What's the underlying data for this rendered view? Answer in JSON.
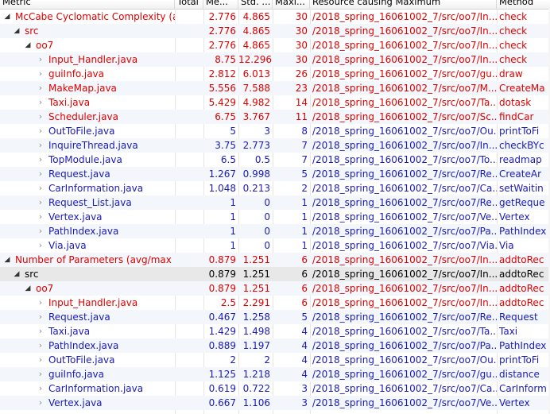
{
  "headers": {
    "metric": "Metric",
    "total": "Total",
    "mean": "Me...",
    "std": "Std. ...",
    "max": "Maxi...",
    "resource": "Resource causing Maximum",
    "method": "Method"
  },
  "rows": [
    {
      "metric": "McCabe Cyclomatic Complexity (a",
      "mean": "2.776",
      "std": "4.865",
      "max": "30",
      "resource": "/2018_spring_16061002_7/src/oo7/In...",
      "method": "check",
      "color": "red",
      "level": 0,
      "expander": "expanded"
    },
    {
      "metric": "src",
      "mean": "2.776",
      "std": "4.865",
      "max": "30",
      "resource": "/2018_spring_16061002_7/src/oo7/In...",
      "method": "check",
      "color": "red",
      "level": 1,
      "expander": "expanded"
    },
    {
      "metric": "oo7",
      "mean": "2.776",
      "std": "4.865",
      "max": "30",
      "resource": "/2018_spring_16061002_7/src/oo7/In...",
      "method": "check",
      "color": "red",
      "level": 2,
      "expander": "expanded"
    },
    {
      "metric": "Input_Handler.java",
      "mean": "8.75",
      "std": "12.296",
      "max": "30",
      "resource": "/2018_spring_16061002_7/src/oo7/In...",
      "method": "check",
      "color": "red",
      "level": 3,
      "expander": "collapsed"
    },
    {
      "metric": "guiInfo.java",
      "mean": "2.812",
      "std": "6.013",
      "max": "26",
      "resource": "/2018_spring_16061002_7/src/oo7/gu...",
      "method": "draw",
      "color": "red",
      "level": 3,
      "expander": "collapsed"
    },
    {
      "metric": "MakeMap.java",
      "mean": "5.556",
      "std": "7.588",
      "max": "23",
      "resource": "/2018_spring_16061002_7/src/oo7/M...",
      "method": "CreateMa",
      "color": "red",
      "level": 3,
      "expander": "collapsed"
    },
    {
      "metric": "Taxi.java",
      "mean": "5.429",
      "std": "4.982",
      "max": "14",
      "resource": "/2018_spring_16061002_7/src/oo7/Ta...",
      "method": "dotask",
      "color": "red",
      "level": 3,
      "expander": "collapsed"
    },
    {
      "metric": "Scheduler.java",
      "mean": "6.75",
      "std": "3.767",
      "max": "11",
      "resource": "/2018_spring_16061002_7/src/oo7/Sc...",
      "method": "findCar",
      "color": "red",
      "level": 3,
      "expander": "collapsed"
    },
    {
      "metric": "OutToFile.java",
      "mean": "5",
      "std": "3",
      "max": "8",
      "resource": "/2018_spring_16061002_7/src/oo7/Ou...",
      "method": "printToFi",
      "color": "blue",
      "level": 3,
      "expander": "collapsed"
    },
    {
      "metric": "InquireThread.java",
      "mean": "3.75",
      "std": "2.773",
      "max": "7",
      "resource": "/2018_spring_16061002_7/src/oo7/In...",
      "method": "checkBYc",
      "color": "blue",
      "level": 3,
      "expander": "collapsed"
    },
    {
      "metric": "TopModule.java",
      "mean": "6.5",
      "std": "0.5",
      "max": "7",
      "resource": "/2018_spring_16061002_7/src/oo7/To...",
      "method": "readmap",
      "color": "blue",
      "level": 3,
      "expander": "collapsed"
    },
    {
      "metric": "Request.java",
      "mean": "1.267",
      "std": "0.998",
      "max": "5",
      "resource": "/2018_spring_16061002_7/src/oo7/Re...",
      "method": "CreateAr",
      "color": "blue",
      "level": 3,
      "expander": "collapsed"
    },
    {
      "metric": "CarInformation.java",
      "mean": "1.048",
      "std": "0.213",
      "max": "2",
      "resource": "/2018_spring_16061002_7/src/oo7/Ca...",
      "method": "setWaitin",
      "color": "blue",
      "level": 3,
      "expander": "collapsed"
    },
    {
      "metric": "Request_List.java",
      "mean": "1",
      "std": "0",
      "max": "1",
      "resource": "/2018_spring_16061002_7/src/oo7/Re...",
      "method": "getReque",
      "color": "blue",
      "level": 3,
      "expander": "collapsed"
    },
    {
      "metric": "Vertex.java",
      "mean": "1",
      "std": "0",
      "max": "1",
      "resource": "/2018_spring_16061002_7/src/oo7/Ve...",
      "method": "Vertex",
      "color": "blue",
      "level": 3,
      "expander": "collapsed"
    },
    {
      "metric": "PathIndex.java",
      "mean": "1",
      "std": "0",
      "max": "1",
      "resource": "/2018_spring_16061002_7/src/oo7/Pa...",
      "method": "PathIndex",
      "color": "blue",
      "level": 3,
      "expander": "collapsed"
    },
    {
      "metric": "Via.java",
      "mean": "1",
      "std": "0",
      "max": "1",
      "resource": "/2018_spring_16061002_7/src/oo7/Via...",
      "method": "Via",
      "color": "blue",
      "level": 3,
      "expander": "collapsed"
    },
    {
      "metric": "Number of Parameters (avg/max p",
      "mean": "0.879",
      "std": "1.251",
      "max": "6",
      "resource": "/2018_spring_16061002_7/src/oo7/In...",
      "method": "addtoRec",
      "color": "red",
      "level": 0,
      "expander": "expanded"
    },
    {
      "metric": "src",
      "mean": "0.879",
      "std": "1.251",
      "max": "6",
      "resource": "/2018_spring_16061002_7/src/oo7/In...",
      "method": "addtoRec",
      "color": "black",
      "level": 1,
      "expander": "expanded",
      "selected": true
    },
    {
      "metric": "oo7",
      "mean": "0.879",
      "std": "1.251",
      "max": "6",
      "resource": "/2018_spring_16061002_7/src/oo7/In...",
      "method": "addtoRec",
      "color": "red",
      "level": 2,
      "expander": "expanded"
    },
    {
      "metric": "Input_Handler.java",
      "mean": "2.5",
      "std": "2.291",
      "max": "6",
      "resource": "/2018_spring_16061002_7/src/oo7/In...",
      "method": "addtoRec",
      "color": "red",
      "level": 3,
      "expander": "collapsed"
    },
    {
      "metric": "Request.java",
      "mean": "0.467",
      "std": "1.258",
      "max": "5",
      "resource": "/2018_spring_16061002_7/src/oo7/Re...",
      "method": "Request",
      "color": "blue",
      "level": 3,
      "expander": "collapsed"
    },
    {
      "metric": "Taxi.java",
      "mean": "1.429",
      "std": "1.498",
      "max": "4",
      "resource": "/2018_spring_16061002_7/src/oo7/Ta...",
      "method": "Taxi",
      "color": "blue",
      "level": 3,
      "expander": "collapsed"
    },
    {
      "metric": "PathIndex.java",
      "mean": "0.889",
      "std": "1.197",
      "max": "4",
      "resource": "/2018_spring_16061002_7/src/oo7/Pa...",
      "method": "PathIndex",
      "color": "blue",
      "level": 3,
      "expander": "collapsed"
    },
    {
      "metric": "OutToFile.java",
      "mean": "2",
      "std": "2",
      "max": "4",
      "resource": "/2018_spring_16061002_7/src/oo7/Ou...",
      "method": "printToFi",
      "color": "blue",
      "level": 3,
      "expander": "collapsed"
    },
    {
      "metric": "guiInfo.java",
      "mean": "1.125",
      "std": "1.218",
      "max": "4",
      "resource": "/2018_spring_16061002_7/src/oo7/gu...",
      "method": "distance",
      "color": "blue",
      "level": 3,
      "expander": "collapsed"
    },
    {
      "metric": "CarInformation.java",
      "mean": "0.619",
      "std": "0.722",
      "max": "3",
      "resource": "/2018_spring_16061002_7/src/oo7/Ca...",
      "method": "CarInform",
      "color": "blue",
      "level": 3,
      "expander": "collapsed"
    },
    {
      "metric": "Vertex.java",
      "mean": "0.667",
      "std": "1.106",
      "max": "3",
      "resource": "/2018_spring_16061002_7/src/oo7/Ve...",
      "method": "Vertex",
      "color": "blue",
      "level": 3,
      "expander": "collapsed"
    }
  ],
  "colors": {
    "red": "#e00000",
    "blue": "#1a1ab8",
    "black": "#000000"
  }
}
